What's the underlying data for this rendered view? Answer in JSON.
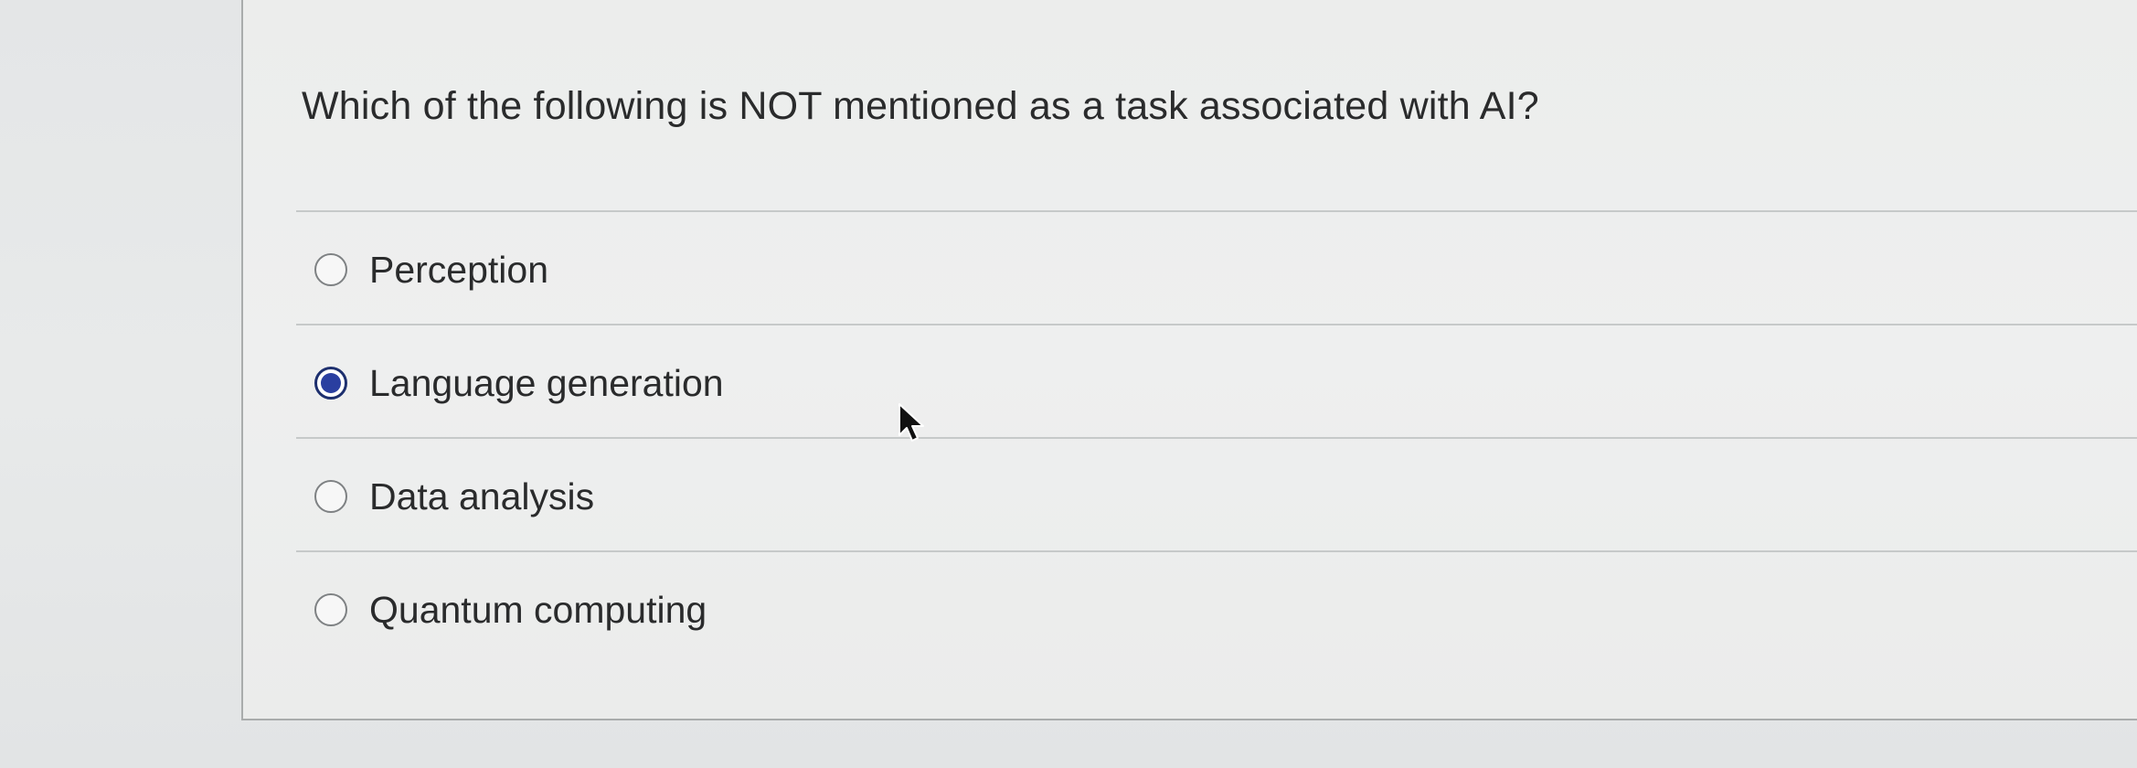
{
  "question": {
    "text": "Which of the following is NOT mentioned as a task associated with AI?"
  },
  "answers": [
    {
      "label": "Perception",
      "selected": false
    },
    {
      "label": "Language generation",
      "selected": true
    },
    {
      "label": "Data analysis",
      "selected": false
    },
    {
      "label": "Quantum computing",
      "selected": false
    }
  ],
  "colors": {
    "selected_radio": "#2a3fa0",
    "text": "#2a2b2c",
    "card_background": "#eeefef",
    "divider": "#c6c9c9"
  },
  "icons": {
    "cursor": "mouse-pointer-icon"
  }
}
